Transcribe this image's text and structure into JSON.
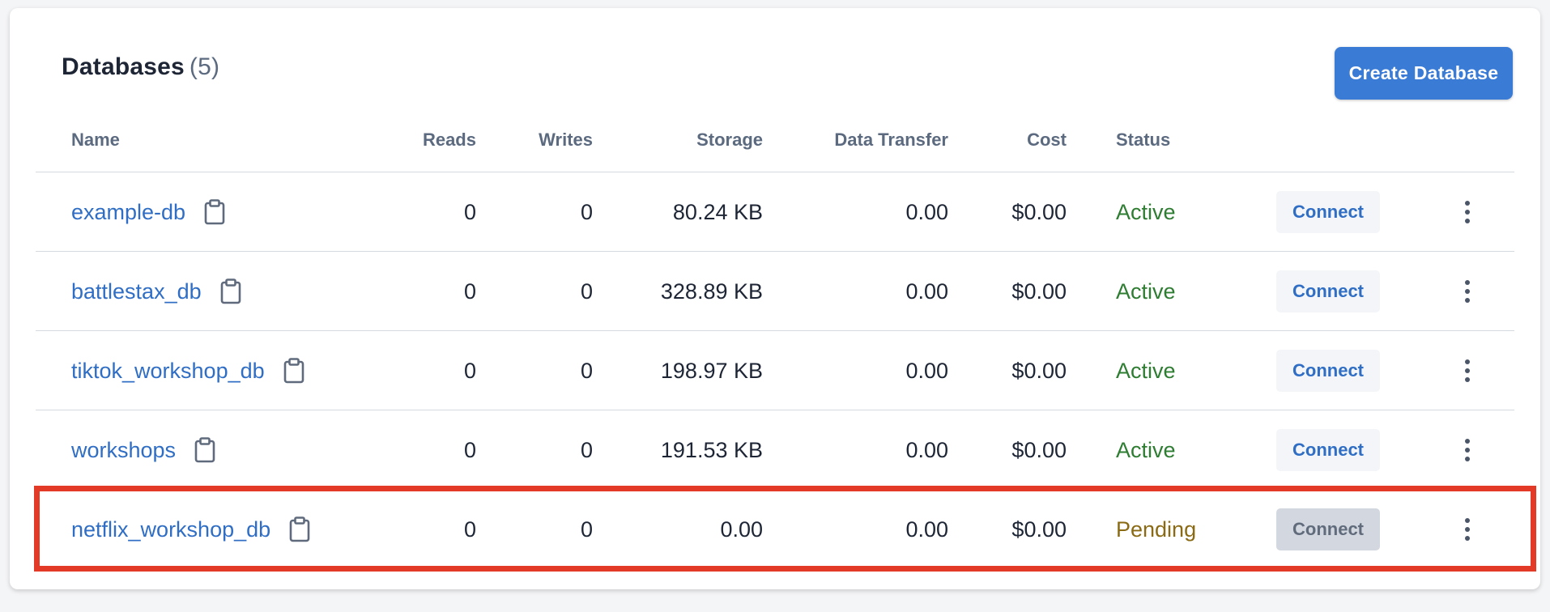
{
  "header": {
    "title": "Databases",
    "count": "(5)",
    "create_label": "Create Database"
  },
  "columns": {
    "name": "Name",
    "reads": "Reads",
    "writes": "Writes",
    "storage": "Storage",
    "transfer": "Data Transfer",
    "cost": "Cost",
    "status": "Status"
  },
  "rows": [
    {
      "name": "example-db",
      "reads": "0",
      "writes": "0",
      "storage": "80.24 KB",
      "transfer": "0.00",
      "cost": "$0.00",
      "status": "Active",
      "connect": "Connect"
    },
    {
      "name": "battlestax_db",
      "reads": "0",
      "writes": "0",
      "storage": "328.89 KB",
      "transfer": "0.00",
      "cost": "$0.00",
      "status": "Active",
      "connect": "Connect"
    },
    {
      "name": "tiktok_workshop_db",
      "reads": "0",
      "writes": "0",
      "storage": "198.97 KB",
      "transfer": "0.00",
      "cost": "$0.00",
      "status": "Active",
      "connect": "Connect"
    },
    {
      "name": "workshops",
      "reads": "0",
      "writes": "0",
      "storage": "191.53 KB",
      "transfer": "0.00",
      "cost": "$0.00",
      "status": "Active",
      "connect": "Connect"
    },
    {
      "name": "netflix_workshop_db",
      "reads": "0",
      "writes": "0",
      "storage": "0.00",
      "transfer": "0.00",
      "cost": "$0.00",
      "status": "Pending",
      "connect": "Connect"
    }
  ],
  "icons": {
    "copy": "clipboard-icon",
    "more": "kebab-menu-icon"
  },
  "colors": {
    "primary": "#3a7bd5",
    "link": "#2f6ec4",
    "active": "#2e7d32",
    "pending": "#8a6a14",
    "highlight": "#e23a26"
  }
}
